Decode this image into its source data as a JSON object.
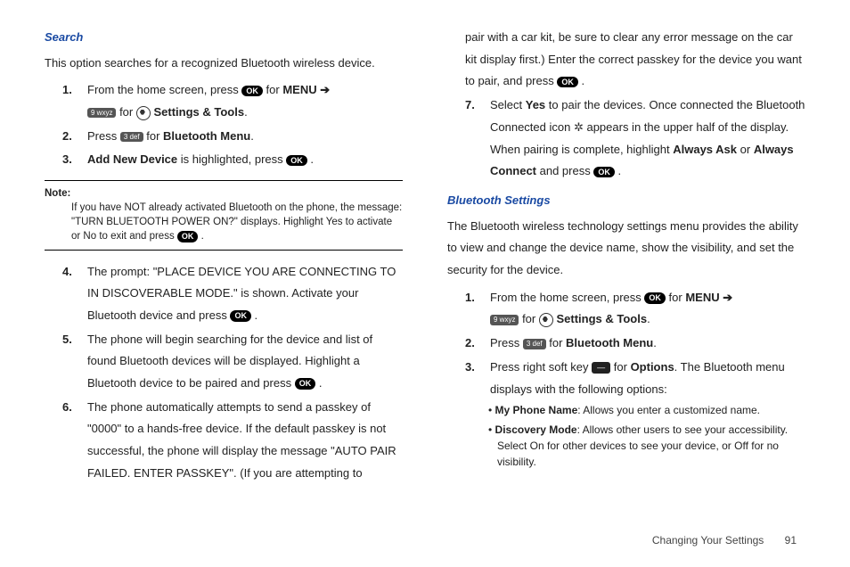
{
  "left": {
    "search_title": "Search",
    "search_intro": "This option searches for a recognized Bluetooth wireless device.",
    "s1_a": "From the home screen, press ",
    "s1_b": " for ",
    "s1_menu": "MENU",
    "s1_arrow": "  ➔",
    "s1_c": " for ",
    "s1_tools": " Settings & Tools",
    "s2_a": "Press ",
    "s2_b": " for ",
    "s2_bt": "Bluetooth Menu",
    "s3_a": "Add New Device",
    "s3_b": " is highlighted, press ",
    "note_label": "Note:",
    "note_text": "If you have NOT already activated Bluetooth on the phone, the message: \"TURN BLUETOOTH POWER ON?\" displays. Highlight Yes to activate or No to exit and press ",
    "s4": "The prompt: \"PLACE DEVICE YOU ARE CONNECTING TO IN DISCOVERABLE MODE.\" is shown. Activate your Bluetooth device and press ",
    "s5": "The phone will begin searching for the device and list of found Bluetooth devices will be displayed. Highlight a Bluetooth device to be paired and press ",
    "s6": "The phone automatically attempts to send a passkey of \"0000\" to a hands-free device. If the default passkey is not successful, the phone will display the message \"AUTO PAIR FAILED. ENTER PASSKEY\". (If you are attempting to "
  },
  "right": {
    "cont": "pair with a car kit, be sure to clear any error message on the car kit display first.) Enter the correct passkey for the device you want to pair, and press ",
    "s7_a": "Select ",
    "s7_yes": "Yes",
    "s7_b": " to pair the devices. Once connected the Bluetooth Connected icon ",
    "s7_c": " appears in the upper half of the display. When pairing is complete, highlight ",
    "s7_always_ask": "Always Ask",
    "s7_or": " or ",
    "s7_always_connect": "Always Connect",
    "s7_d": " and press ",
    "bt_title": "Bluetooth Settings",
    "bt_intro": "The Bluetooth wireless technology settings menu provides the ability to view and change the device name, show the visibility, and set the security for the device.",
    "b1_a": "From the home screen, press ",
    "b1_b": " for ",
    "b1_menu": "MENU",
    "b1_arrow": "  ➔",
    "b1_c": " for ",
    "b1_tools": " Settings & Tools",
    "b2_a": "Press ",
    "b2_b": " for ",
    "b2_bt": "Bluetooth Menu",
    "b3_a": "Press right soft key ",
    "b3_b": " for ",
    "b3_opt": "Options",
    "b3_c": ". The Bluetooth menu displays with the following options:",
    "bullet1_a": "My Phone Name",
    "bullet1_b": ": Allows you enter a customized name.",
    "bullet2_a": "Discovery Mode",
    "bullet2_b": ": Allows other users to see your accessibility. Select On for other devices to see your device, or Off for no visibility."
  },
  "icons": {
    "ok": "OK",
    "key9": "9 wxyz",
    "key3": "3 def",
    "dash": "—",
    "bt": "✲"
  },
  "footer": {
    "chapter": "Changing Your Settings",
    "page": "91"
  }
}
